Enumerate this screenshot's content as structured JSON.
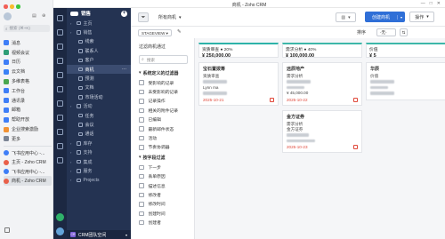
{
  "window": {
    "title": "商机 - Zoho CRM",
    "controls": [
      "—",
      "□",
      "✕"
    ]
  },
  "app_sidebar": {
    "search_placeholder": "搜索 (⌘+K)",
    "apps": [
      {
        "label": "消息",
        "color": "#3e7ef7"
      },
      {
        "label": "视频会议",
        "color": "#2f9e76"
      },
      {
        "label": "日历",
        "color": "#3e7ef7"
      },
      {
        "label": "云文档",
        "color": "#3b82f6"
      },
      {
        "label": "多维表格",
        "color": "#4aa84f"
      },
      {
        "label": "工作台",
        "color": "#3e7ef7"
      },
      {
        "label": "通讯录",
        "color": "#3e7ef7"
      },
      {
        "label": "邮箱",
        "color": "#3e7ef7"
      },
      {
        "label": "帮助开放",
        "color": "#3e7ef7"
      },
      {
        "label": "企业搜索激励",
        "color": "#f29233"
      },
      {
        "label": "更多",
        "color": "#7b8494"
      }
    ],
    "recent": [
      {
        "label": "飞书应用中心 -...",
        "color": "#3e7ef7",
        "active": false
      },
      {
        "label": "主页 - Zoho CRM",
        "color": "#e9604a",
        "active": false
      },
      {
        "label": "飞书应用中心 -...",
        "color": "#3e7ef7",
        "active": false
      },
      {
        "label": "商机 - Zoho CRM",
        "color": "#e9604a",
        "active": true
      }
    ]
  },
  "crm_nav": {
    "header": "销售",
    "items": [
      {
        "label": "主页",
        "type": "grp"
      },
      {
        "label": "销售",
        "type": "grp"
      },
      {
        "label": "线索",
        "type": "sub"
      },
      {
        "label": "联系人",
        "type": "sub"
      },
      {
        "label": "客户",
        "type": "sub"
      },
      {
        "label": "商机",
        "type": "sub",
        "active": true
      },
      {
        "label": "预测",
        "type": "sub"
      },
      {
        "label": "文档",
        "type": "sub"
      },
      {
        "label": "市场活动",
        "type": "sub"
      },
      {
        "label": "活动",
        "type": "grp"
      },
      {
        "label": "任务",
        "type": "sub"
      },
      {
        "label": "会议",
        "type": "sub"
      },
      {
        "label": "通话",
        "type": "sub"
      },
      {
        "label": "库存",
        "type": "grp"
      },
      {
        "label": "支持",
        "type": "grp"
      },
      {
        "label": "集成",
        "type": "grp"
      },
      {
        "label": "服务",
        "type": "grp"
      },
      {
        "label": "Projects",
        "type": "grp"
      }
    ],
    "workspace": "CRM团队空间",
    "workspace_badge": "CR"
  },
  "toolbar": {
    "view_label": "所有商机",
    "create_label": "创建商机",
    "actions_label": "操作",
    "stage_view": "STAGEVIEW",
    "sort_label": "排序",
    "sort_value": "-无-"
  },
  "filters": {
    "heading": "过滤商机通过",
    "search_placeholder": "搜索",
    "system_section": "系统定义的过滤器",
    "system": [
      "受影响的记录",
      "未受影响的记录",
      "记录操作",
      "相关的附件记录",
      "已编辑",
      "最新邮件状态",
      "活动",
      "节奏协调器"
    ],
    "field_section": "按字段过滤",
    "fields": [
      "下一步",
      "丢单原因",
      "描述信息",
      "修改者",
      "修改时间",
      "创建时间",
      "创建者"
    ]
  },
  "board": {
    "columns": [
      {
        "name": "资质审查 ● 20%",
        "amount": "¥ 250,000.00",
        "color": "#2db3a9",
        "cards": [
          {
            "title": "宝石置拨筹",
            "lines": [
              "资质审查",
              "",
              "Lynn ma",
              ""
            ],
            "date": "2025-10-21"
          }
        ]
      },
      {
        "name": "需求分析 ● 40%",
        "amount": "¥ 100,000.00",
        "color": "#3db7a9",
        "cards": [
          {
            "title": "远辰地产",
            "lines": [
              "需求分析",
              "",
              "",
              "¥ 45,000.00"
            ],
            "date": "2025-10-22"
          },
          {
            "title": "金方证券",
            "lines": [
              "需求分析",
              "金方证券",
              "",
              ""
            ],
            "date": "2025-10-23"
          }
        ]
      },
      {
        "name": "价值",
        "amount": "¥ 5",
        "color": "#3db7a9",
        "cards": [
          {
            "title": "华辰",
            "lines": [
              "价值",
              "",
              "",
              ""
            ],
            "date": ""
          }
        ]
      }
    ]
  }
}
